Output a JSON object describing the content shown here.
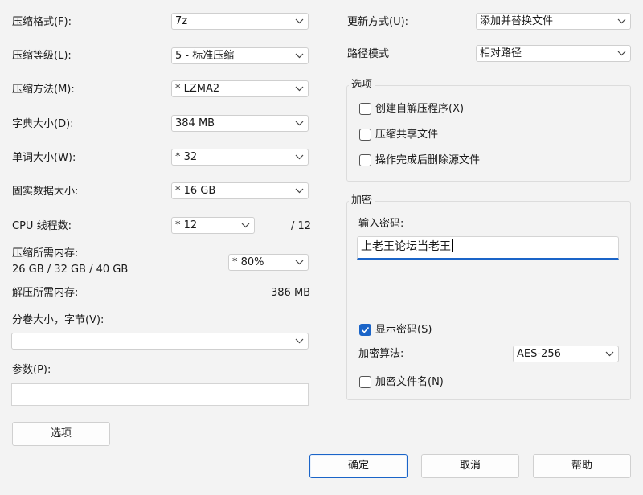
{
  "left": {
    "format": {
      "label": "压缩格式(F):",
      "value": "7z"
    },
    "level": {
      "label": "压缩等级(L):",
      "value": "5 - 标准压缩"
    },
    "method": {
      "label": "压缩方法(M):",
      "value": "*  LZMA2"
    },
    "dict": {
      "label": "字典大小(D):",
      "value": "384 MB"
    },
    "word": {
      "label": "单词大小(W):",
      "value": "*  32"
    },
    "solid": {
      "label": "固实数据大小:",
      "value": "*  16 GB"
    },
    "threads": {
      "label": "CPU 线程数:",
      "value": "*  12",
      "max": "/ 12"
    },
    "mem_compress": {
      "label": "压缩所需内存:",
      "detail": "26 GB / 32 GB / 40 GB",
      "value": "*  80%"
    },
    "mem_decompress": {
      "label": "解压所需内存:",
      "value": "386 MB"
    },
    "volume": {
      "label": "分卷大小，字节(V):",
      "value": ""
    },
    "params": {
      "label": "参数(P):",
      "value": ""
    },
    "options_button": "选项"
  },
  "right": {
    "update": {
      "label": "更新方式(U):",
      "value": "添加并替换文件"
    },
    "path": {
      "label": "路径模式",
      "value": "相对路径"
    },
    "options_group": {
      "title": "选项",
      "sfx": "创建自解压程序(X)",
      "shared": "压缩共享文件",
      "delete": "操作完成后删除源文件"
    },
    "encryption": {
      "title": "加密",
      "password_label": "输入密码:",
      "password_value": "上老王论坛当老王",
      "show_password": "显示密码(S)",
      "method_label": "加密算法:",
      "method_value": "AES-256",
      "encrypt_names": "加密文件名(N)"
    }
  },
  "buttons": {
    "ok": "确定",
    "cancel": "取消",
    "help": "帮助"
  },
  "colors": {
    "accent": "#1a64c8",
    "background": "#f3f3f3"
  }
}
